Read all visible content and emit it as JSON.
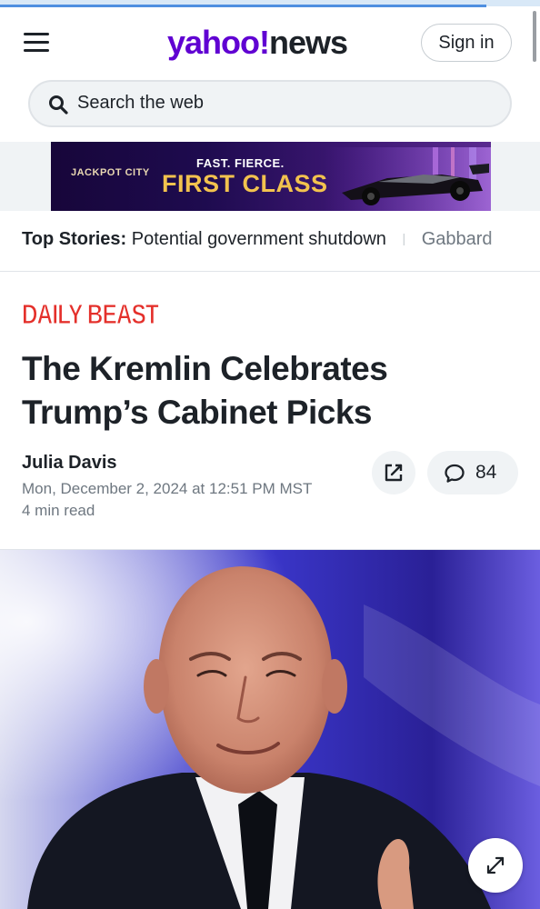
{
  "header": {
    "logo_brand": "yahoo!",
    "logo_product": "news",
    "sign_in_label": "Sign in",
    "menu_icon": "hamburger-menu-icon",
    "search_placeholder": "Search the web",
    "search_icon": "search-icon"
  },
  "ad": {
    "logo_text": "JACKPOT CITY",
    "tagline": "FAST. FIERCE.",
    "headline": "FIRST CLASS"
  },
  "top_stories": {
    "label": "Top Stories:",
    "items": [
      "Potential government shutdown",
      "Gabbard"
    ]
  },
  "article": {
    "publisher": "DAILY BEAST",
    "headline": "The Kremlin Celebrates Trump’s Cabinet Picks",
    "author": "Julia Davis",
    "timestamp": "Mon, December 2, 2024 at 12:51 PM MST",
    "read_time": "4 min read",
    "share_icon": "share-external-icon",
    "comment_icon": "comment-bubble-icon",
    "comment_count": "84",
    "expand_icon": "expand-arrows-icon"
  },
  "colors": {
    "brand_purple": "#6001d2",
    "text_primary": "#1d2228",
    "text_secondary": "#6e7780",
    "publisher_red": "#e4302b",
    "pill_background": "#f0f3f5",
    "progress_blue": "#4f8fe0"
  },
  "reading_progress": 0.9
}
